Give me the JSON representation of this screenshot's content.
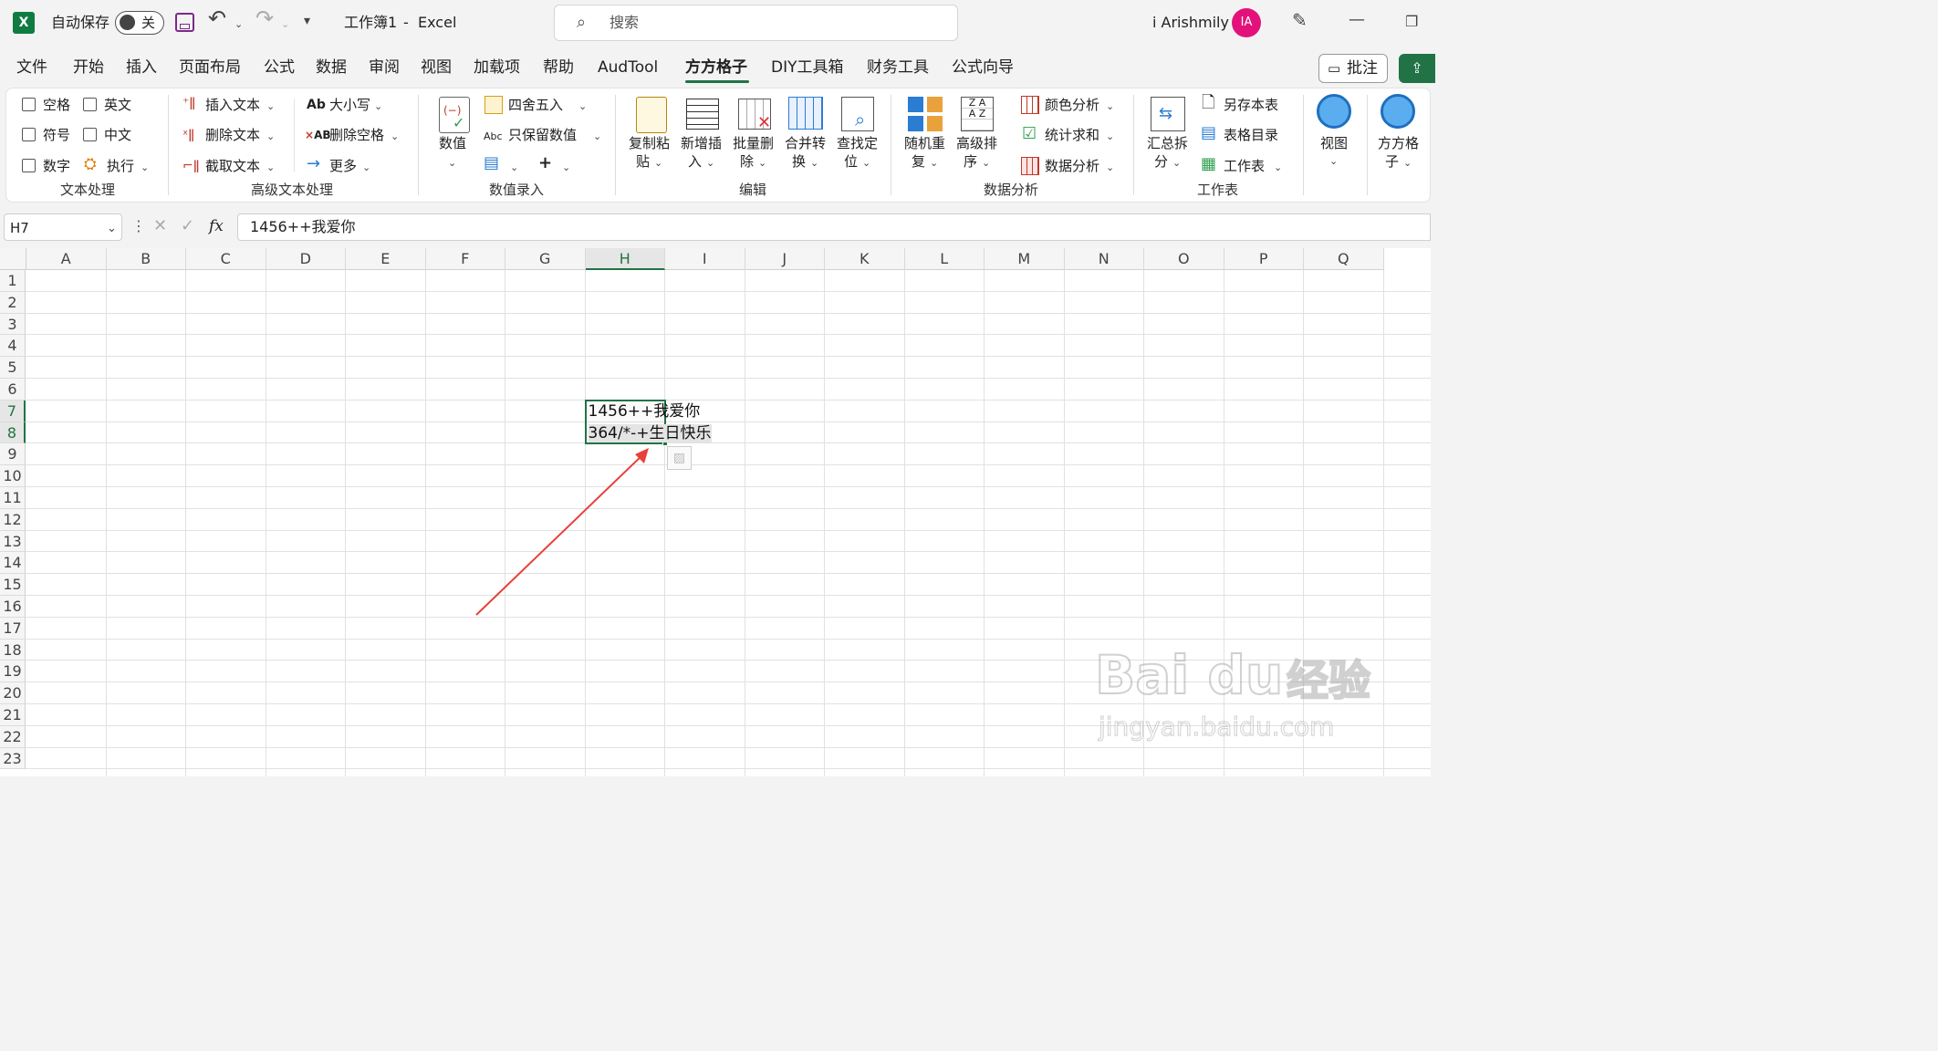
{
  "titlebar": {
    "autosave_label": "自动保存",
    "autosave_toggle": "关",
    "doc_title": "工作簿1",
    "title_sep": "-",
    "app_name": "Excel",
    "search_placeholder": "搜索",
    "user_name": "i Arishmily",
    "avatar_initials": "IA"
  },
  "menu": [
    "文件",
    "开始",
    "插入",
    "页面布局",
    "公式",
    "数据",
    "审阅",
    "视图",
    "加载项",
    "帮助",
    "AudTool",
    "方方格子",
    "DIY工具箱",
    "财务工具",
    "公式向导"
  ],
  "menu_active": "方方格子",
  "comment_button": "批注",
  "ribbon": {
    "text_proc": {
      "checkboxes": [
        "空格",
        "英文",
        "符号",
        "中文",
        "数字"
      ],
      "execute": "执行",
      "group_label": "文本处理"
    },
    "adv_text": {
      "items": [
        "插入文本",
        "删除文本",
        "截取文本",
        "大小写",
        "删除空格",
        "更多"
      ],
      "group_label": "高级文本处理"
    },
    "num_entry": {
      "value_label": "数值",
      "round": "四舍五入",
      "keep_numbers": "只保留数值",
      "group_label": "数值录入"
    },
    "edit": {
      "buttons": [
        "复制粘",
        "贴",
        "新增插",
        "入",
        "批量删",
        "除",
        "合并转",
        "换",
        "查找定",
        "位"
      ],
      "group_label": "编辑"
    },
    "data_analysis": {
      "random_line1": "随机重",
      "random_line2": "复",
      "sort_line1": "高级排",
      "sort_line2": "序",
      "items": [
        "颜色分析",
        "统计求和",
        "数据分析"
      ],
      "group_label": "数据分析"
    },
    "worksheet": {
      "split_line1": "汇总拆",
      "split_line2": "分",
      "items": [
        "另存本表",
        "表格目录",
        "工作表"
      ],
      "group_label": "工作表"
    },
    "view_label": "视图",
    "ffgz_line1": "方方格",
    "ffgz_line2": "子"
  },
  "formula_bar": {
    "name_box": "H7",
    "fx": "fx",
    "formula": "1456++我爱你"
  },
  "columns": [
    "A",
    "B",
    "C",
    "D",
    "E",
    "F",
    "G",
    "H",
    "I",
    "J",
    "K",
    "L",
    "M",
    "N",
    "O",
    "P",
    "Q"
  ],
  "rows": [
    "1",
    "2",
    "3",
    "4",
    "5",
    "6",
    "7",
    "8",
    "9",
    "10",
    "11",
    "12",
    "13",
    "14",
    "15",
    "16",
    "17",
    "18",
    "19",
    "20",
    "21",
    "22",
    "23"
  ],
  "cells": {
    "H7": "1456++我爱你",
    "H8": "364/*-+生日快乐"
  },
  "watermark": {
    "brand": "Bai du",
    "cn": "经验",
    "url": "jingyan.baidu.com"
  },
  "colors": {
    "excel_green": "#107c41",
    "accent_green": "#217346",
    "avatar_pink": "#e3127a",
    "arrow_red": "#e8403a"
  }
}
